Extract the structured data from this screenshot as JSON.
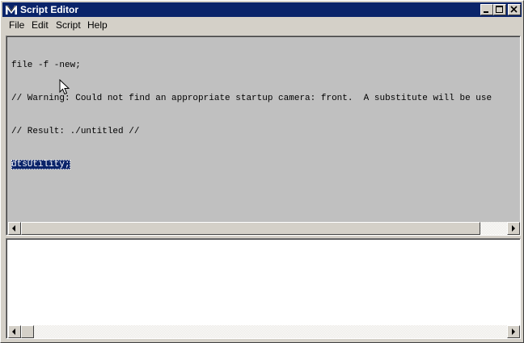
{
  "window": {
    "title": "Script Editor"
  },
  "caption_buttons": [
    "minimize",
    "maximize",
    "close"
  ],
  "menu": [
    "File",
    "Edit",
    "Script",
    "Help"
  ],
  "history": {
    "lines": [
      "file -f -new;",
      "// Warning: Could not find an appropriate startup camera: front.  A substitute will be use",
      "// Result: ./untitled //"
    ],
    "selected_line": "dtsUtility;"
  },
  "input": {
    "value": ""
  },
  "icons": {
    "app": "maya-logo-icon",
    "minimize": "minimize-icon",
    "maximize": "maximize-icon",
    "close": "close-icon",
    "scroll_left": "arrow-left-icon",
    "scroll_right": "arrow-right-icon",
    "cursor": "mouse-pointer-icon"
  },
  "colors": {
    "titlebar": "#0a246a",
    "face": "#d4d0c8",
    "history_bg": "#c0c0c0",
    "input_bg": "#ffffff",
    "selection": "#0a246a"
  }
}
